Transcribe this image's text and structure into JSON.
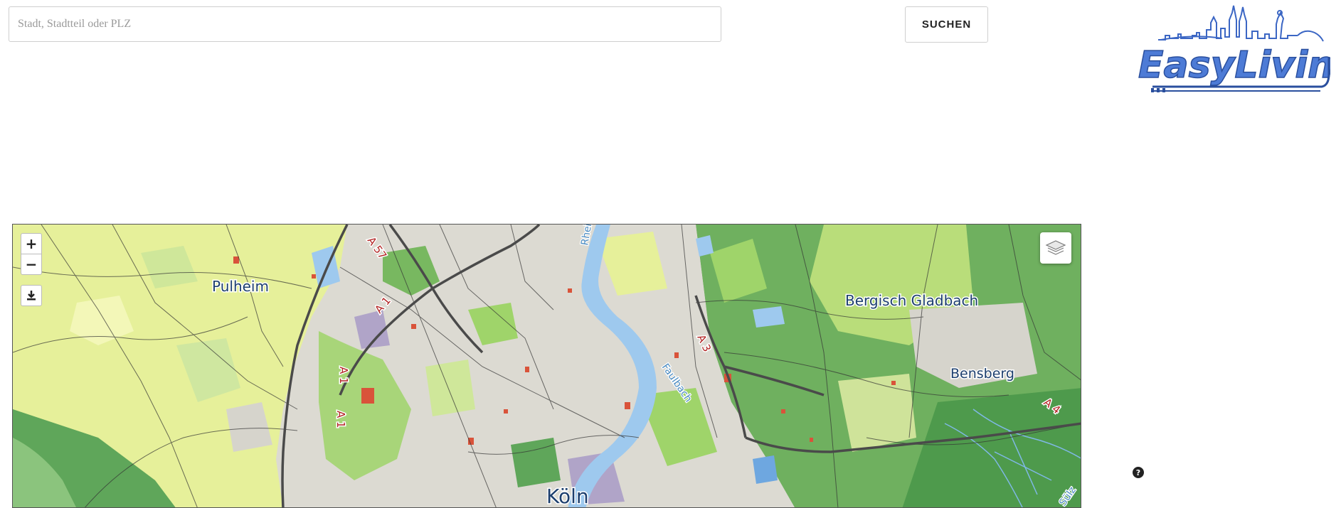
{
  "search": {
    "placeholder": "Stadt, Stadtteil oder PLZ",
    "button_label": "SUCHEN"
  },
  "logo": {
    "text": "EasyLiving",
    "color": "#2f5fb8"
  },
  "map": {
    "controls": {
      "zoom_in": "+",
      "zoom_out": "−",
      "download_icon": "download-icon",
      "layers_icon": "layers-icon"
    },
    "places": {
      "pulheim": "Pulheim",
      "bergisch_gladbach": "Bergisch Gladbach",
      "bensberg": "Bensberg",
      "koeln": "Köln"
    },
    "roads": {
      "a57": "A 57",
      "a1_north": "A 1",
      "a1_mid": "A 1",
      "a1_south": "A 1",
      "a3": "A 3",
      "a4": "A 4"
    },
    "waters": {
      "rhein": "Rhein",
      "faulbach": "Faulbach",
      "sulz": "Sülz"
    },
    "colors": {
      "urban": "#dcdad2",
      "forest": "#5fa65a",
      "meadow": "#e6f09a",
      "green": "#9fd46a",
      "water": "#9ec9ee"
    }
  },
  "help": {
    "icon": "help-icon",
    "label": "?"
  }
}
